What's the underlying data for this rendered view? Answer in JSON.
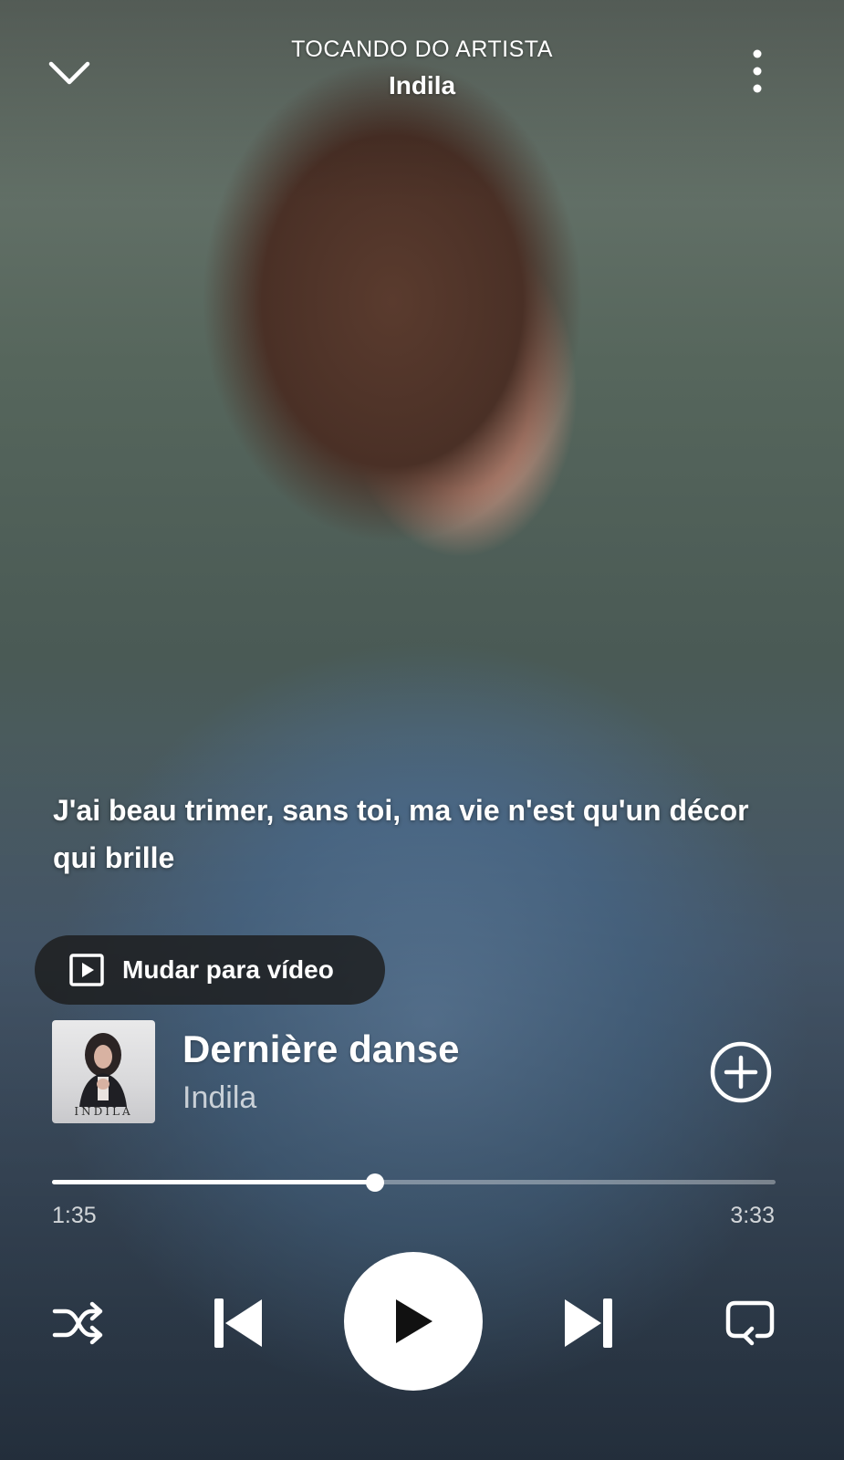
{
  "header": {
    "context_label": "TOCANDO DO ARTISTA",
    "context_name": "Indila",
    "collapse_icon": "chevron-down-icon",
    "menu_icon": "more-vertical-icon"
  },
  "lyrics": {
    "current_line": "J'ai beau trimer, sans toi, ma vie n'est qu'un décor qui brille"
  },
  "video_switch": {
    "label": "Mudar para vídeo",
    "icon": "play-video-icon"
  },
  "track": {
    "title": "Dernière danse",
    "artist": "Indila",
    "album_art_text": "INDILA",
    "add_icon": "add-circle-icon"
  },
  "playback": {
    "elapsed": "1:35",
    "total": "3:33",
    "progress_fraction": 0.446
  },
  "controls": {
    "shuffle_icon": "shuffle-icon",
    "previous_icon": "skip-previous-icon",
    "play_icon": "play-icon",
    "next_icon": "skip-next-icon",
    "repeat_icon": "repeat-icon"
  },
  "colors": {
    "accent": "#ffffff",
    "pill_background": "#1c1c1c"
  }
}
